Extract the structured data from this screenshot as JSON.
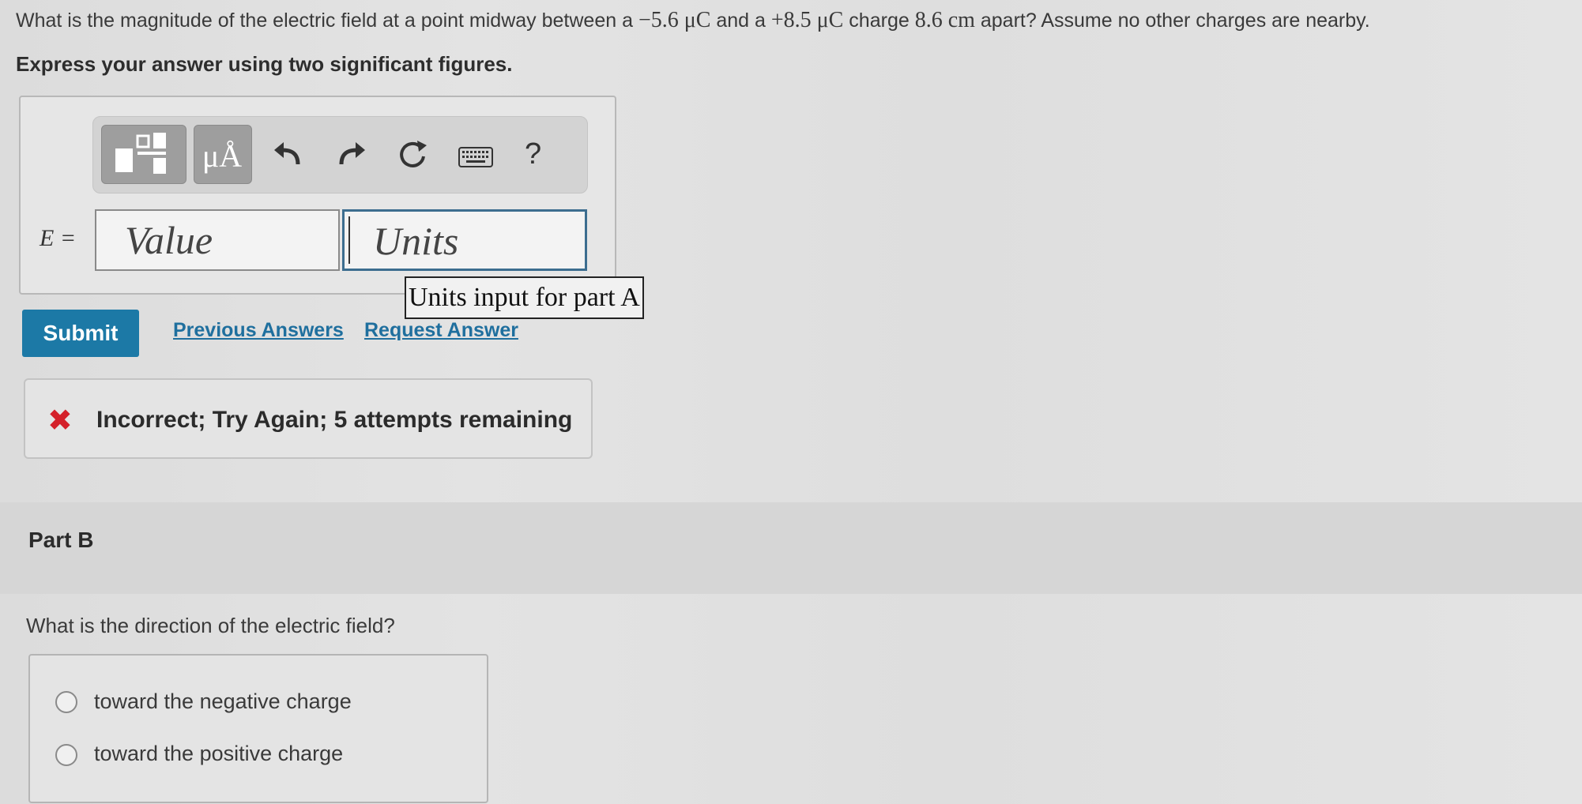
{
  "question": {
    "part1": "What is the magnitude of the electric field at a point midway between a ",
    "charge1": "−5.6 μC",
    "part2": " and a ",
    "charge2": "+8.5 μC",
    "part3": " charge ",
    "distance": "8.6 cm",
    "part4": " apart? Assume no other charges are nearby."
  },
  "instruction": "Express your answer using two significant figures.",
  "toolbar": {
    "template_icon": "template-icon",
    "units_label": "μÅ",
    "undo_icon": "undo-icon",
    "redo_icon": "redo-icon",
    "reset_icon": "reset-icon",
    "keyboard_icon": "keyboard-icon",
    "help_label": "?"
  },
  "answer": {
    "variable_label": "E =",
    "value_placeholder": "Value",
    "units_placeholder": "Units",
    "units_tooltip": "Units input for part A"
  },
  "actions": {
    "submit": "Submit",
    "previous_answers": "Previous Answers",
    "request_answer": "Request Answer"
  },
  "feedback": {
    "icon": "x-icon",
    "text": "Incorrect; Try Again; 5 attempts remaining",
    "color": "#d4202a"
  },
  "part_b": {
    "label": "Part B",
    "question": "What is the direction of the electric field?",
    "choices": [
      "toward the negative charge",
      "toward the positive charge"
    ]
  },
  "colors": {
    "submit_bg": "#1c79a6",
    "link": "#1f6f9e",
    "units_border": "#3c6d8f"
  }
}
